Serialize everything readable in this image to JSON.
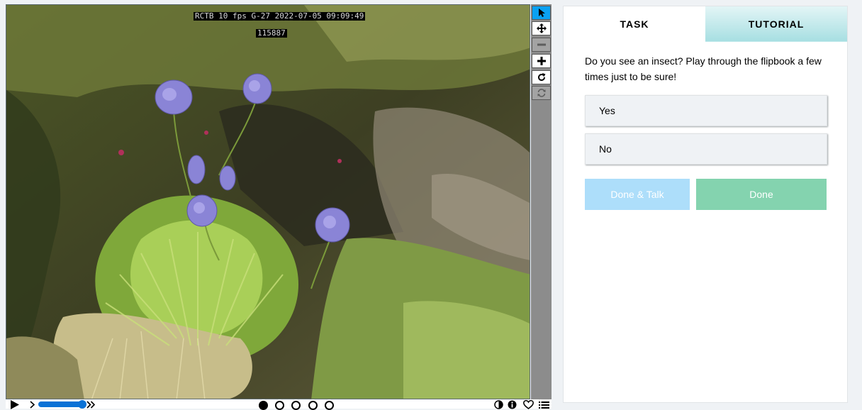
{
  "subject": {
    "overlay_line1": "RCTB  10 fps  G-27  2022-07-05  09:09:49",
    "overlay_line2": "115887"
  },
  "toolbar": {
    "tools": [
      {
        "name": "pointer-icon",
        "state": "active"
      },
      {
        "name": "move-icon",
        "state": "normal"
      },
      {
        "name": "zoom-out-icon",
        "state": "disabled"
      },
      {
        "name": "zoom-in-icon",
        "state": "normal"
      },
      {
        "name": "rotate-icon",
        "state": "normal"
      },
      {
        "name": "reset-icon",
        "state": "disabled"
      }
    ]
  },
  "flipbook": {
    "frame_count": 5,
    "current_frame": 1,
    "speed_fraction": 0.9
  },
  "task": {
    "tabs": [
      {
        "label": "TASK",
        "active": true
      },
      {
        "label": "TUTORIAL",
        "active": false
      }
    ],
    "question": "Do you see an insect? Play through the flipbook a few times just to be sure!",
    "answers": [
      {
        "label": "Yes"
      },
      {
        "label": "No"
      }
    ],
    "done_talk_label": "Done & Talk",
    "done_label": "Done"
  },
  "colors": {
    "active_tool": "#0aa1f2",
    "done_talk": "#addefa",
    "done": "#84d3af",
    "tutorial_tab": "#a7dfe2"
  }
}
